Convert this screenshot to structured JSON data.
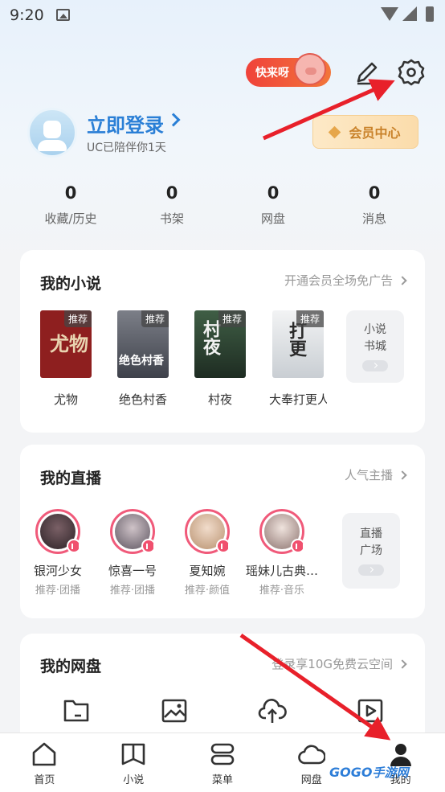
{
  "status_bar": {
    "time": "9:20"
  },
  "header": {
    "promo_label": "快来呀"
  },
  "profile": {
    "login_label": "立即登录",
    "subtitle": "UC已陪伴你1天",
    "vip_label": "会员中心"
  },
  "stats": [
    {
      "value": "0",
      "label": "收藏/历史"
    },
    {
      "value": "0",
      "label": "书架"
    },
    {
      "value": "0",
      "label": "网盘"
    },
    {
      "value": "0",
      "label": "消息"
    }
  ],
  "novels_section": {
    "title": "我的小说",
    "link": "开通会员全场免广告",
    "items": [
      {
        "name": "尤物",
        "tag": "推荐",
        "cover_text": "尤物",
        "cover_color": "#8e1f1f"
      },
      {
        "name": "绝色村香",
        "tag": "推荐",
        "cover_text": "绝色村香",
        "cover_color": "#4a4e57"
      },
      {
        "name": "村夜",
        "tag": "推荐",
        "cover_text": "村夜",
        "cover_color": "#2f4a33"
      },
      {
        "name": "大奉打更人",
        "tag": "推荐",
        "cover_text": "打更",
        "cover_color": "#dfe3e7"
      }
    ],
    "side_tile": {
      "line1": "小说",
      "line2": "书城"
    }
  },
  "live_section": {
    "title": "我的直播",
    "link": "人气主播",
    "items": [
      {
        "name": "银河少女",
        "tag": "推荐·团播",
        "photo_color": "#4b3b3f"
      },
      {
        "name": "惊喜一号",
        "tag": "推荐·团播",
        "photo_color": "#6e6470"
      },
      {
        "name": "夏知婉",
        "tag": "推荐·颜值",
        "photo_color": "#d9b79f"
      },
      {
        "name": "瑶妹儿古典…",
        "tag": "推荐·音乐",
        "photo_color": "#b7a7a4"
      }
    ],
    "side_tile": {
      "line1": "直播",
      "line2": "广场"
    }
  },
  "cloud_section": {
    "title": "我的网盘",
    "link": "登录享10G免费云空间"
  },
  "bottom_nav": [
    {
      "label": "首页",
      "icon": "home-icon"
    },
    {
      "label": "小说",
      "icon": "book-icon"
    },
    {
      "label": "菜单",
      "icon": "menu-icon"
    },
    {
      "label": "网盘",
      "icon": "cloud-icon"
    },
    {
      "label": "我的",
      "icon": "person-icon"
    }
  ],
  "watermark": {
    "brand": "GOGO",
    "text": "手游网"
  },
  "colors": {
    "accent": "#2a7fd6",
    "vip": "#c9822a",
    "live_ring": "#f05a7a",
    "arrow": "#e8202a"
  }
}
